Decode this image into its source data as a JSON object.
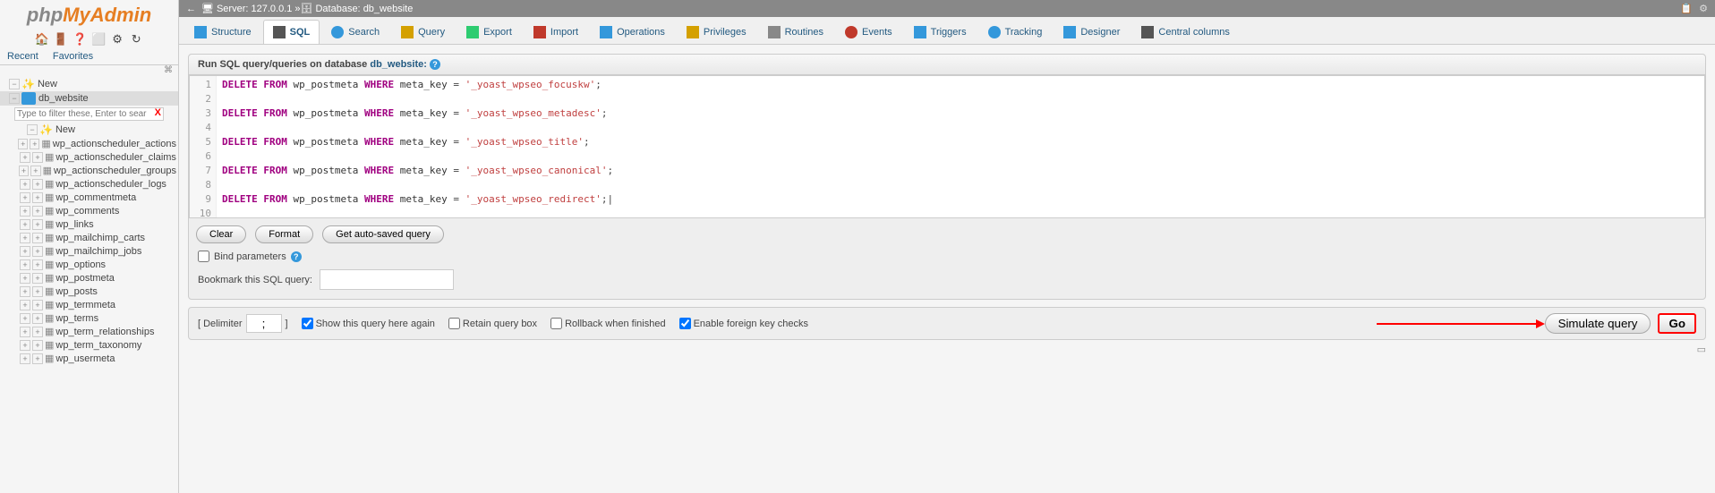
{
  "logo": {
    "part1": "php",
    "part2": "MyAdmin",
    "part3": ""
  },
  "toolbar_icons": [
    "🏠",
    "🚪",
    "❓",
    "⬜",
    "⚙",
    "↻"
  ],
  "sidebar_tabs": {
    "recent": "Recent",
    "favorites": "Favorites"
  },
  "tree": {
    "new_label": "New",
    "db_label": "db_website",
    "filter_placeholder": "Type to filter these, Enter to sear",
    "new_table_label": "New",
    "tables": [
      "wp_actionscheduler_actions",
      "wp_actionscheduler_claims",
      "wp_actionscheduler_groups",
      "wp_actionscheduler_logs",
      "wp_commentmeta",
      "wp_comments",
      "wp_links",
      "wp_mailchimp_carts",
      "wp_mailchimp_jobs",
      "wp_options",
      "wp_postmeta",
      "wp_posts",
      "wp_termmeta",
      "wp_terms",
      "wp_term_relationships",
      "wp_term_taxonomy",
      "wp_usermeta"
    ]
  },
  "breadcrumb": {
    "server_label": "Server:",
    "server_val": "127.0.0.1",
    "db_label": "Database:",
    "db_val": "db_website"
  },
  "topnav": [
    {
      "label": "Structure",
      "cls": "ico-struct"
    },
    {
      "label": "SQL",
      "cls": "ico-sql"
    },
    {
      "label": "Search",
      "cls": "ico-search"
    },
    {
      "label": "Query",
      "cls": "ico-query"
    },
    {
      "label": "Export",
      "cls": "ico-export"
    },
    {
      "label": "Import",
      "cls": "ico-import"
    },
    {
      "label": "Operations",
      "cls": "ico-ops"
    },
    {
      "label": "Privileges",
      "cls": "ico-priv"
    },
    {
      "label": "Routines",
      "cls": "ico-rout"
    },
    {
      "label": "Events",
      "cls": "ico-ev"
    },
    {
      "label": "Triggers",
      "cls": "ico-trig"
    },
    {
      "label": "Tracking",
      "cls": "ico-track"
    },
    {
      "label": "Designer",
      "cls": "ico-des"
    },
    {
      "label": "Central columns",
      "cls": "ico-cc"
    }
  ],
  "panel_title_prefix": "Run SQL query/queries on database ",
  "panel_title_db": "db_website:",
  "sql_lines": [
    {
      "n": "1",
      "kw": "DELETE FROM",
      "tbl": "wp_postmeta",
      "wh": "WHERE",
      "col": "meta_key",
      "op": "=",
      "str": "'_yoast_wpseo_focuskw'",
      "end": ";"
    },
    {
      "n": "2",
      "blank": true
    },
    {
      "n": "3",
      "kw": "DELETE FROM",
      "tbl": "wp_postmeta",
      "wh": "WHERE",
      "col": "meta_key",
      "op": "=",
      "str": "'_yoast_wpseo_metadesc'",
      "end": ";"
    },
    {
      "n": "4",
      "blank": true
    },
    {
      "n": "5",
      "kw": "DELETE FROM",
      "tbl": "wp_postmeta",
      "wh": "WHERE",
      "col": "meta_key",
      "op": "=",
      "str": "'_yoast_wpseo_title'",
      "end": ";"
    },
    {
      "n": "6",
      "blank": true
    },
    {
      "n": "7",
      "kw": "DELETE FROM",
      "tbl": "wp_postmeta",
      "wh": "WHERE",
      "col": "meta_key",
      "op": "=",
      "str": "'_yoast_wpseo_canonical'",
      "end": ";"
    },
    {
      "n": "8",
      "blank": true
    },
    {
      "n": "9",
      "kw": "DELETE FROM",
      "tbl": "wp_postmeta",
      "wh": "WHERE",
      "col": "meta_key",
      "op": "=",
      "str": "'_yoast_wpseo_redirect'",
      "end": ";",
      "cursor": true
    },
    {
      "n": "10",
      "blank": true
    }
  ],
  "buttons": {
    "clear": "Clear",
    "format": "Format",
    "autosave": "Get auto-saved query"
  },
  "bind_params": "Bind parameters",
  "bookmark_label": "Bookmark this SQL query:",
  "footer": {
    "delimiter_label": "[ Delimiter",
    "delimiter_val": ";",
    "delimiter_close": "]",
    "show_again": "Show this query here again",
    "retain": "Retain query box",
    "rollback": "Rollback when finished",
    "fk": "Enable foreign key checks",
    "simulate": "Simulate query",
    "go": "Go"
  }
}
